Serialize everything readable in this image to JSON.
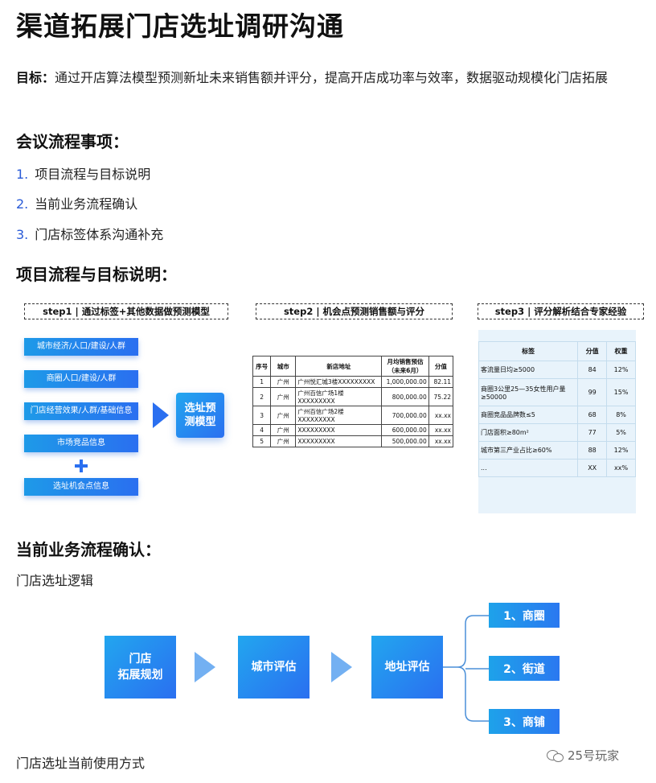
{
  "title": "渠道拓展门店选址调研沟通",
  "goal": {
    "label": "目标：",
    "text": "通过开店算法模型预测新址未来销售额并评分，提高开店成功率与效率，数据驱动规模化门店拓展"
  },
  "agenda": {
    "heading": "会议流程事项：",
    "items": [
      {
        "num": "1.",
        "label": "项目流程与目标说明"
      },
      {
        "num": "2.",
        "label": "当前业务流程确认"
      },
      {
        "num": "3.",
        "label": "门店标签体系沟通补充"
      }
    ]
  },
  "section1": {
    "heading": "项目流程与目标说明：",
    "step1": {
      "label": "step1 | 通过标签+其他数据做预测模型",
      "inputs": [
        "城市经济/人口/建设/人群",
        "商圈人口/建设/人群",
        "门店经营效果/人群/基础信息",
        "市场竞品信息",
        "选址机会点信息"
      ],
      "model": "选址预\n测模型"
    },
    "step2": {
      "label": "step2 | 机会点预测销售额与评分",
      "headers": [
        "序号",
        "城市",
        "新店地址",
        "月均销售预估\n（未来6月）",
        "分值"
      ],
      "rows": [
        [
          "1",
          "广州",
          "广州悦汇城3楼XXXXXXXXX",
          "1,000,000.00",
          "82.11"
        ],
        [
          "2",
          "广州",
          "广州百信广场1楼\nXXXXXXXXX",
          "800,000.00",
          "75.22"
        ],
        [
          "3",
          "广州",
          "广州百信广场2楼\nXXXXXXXXX",
          "700,000.00",
          "xx.xx"
        ],
        [
          "4",
          "广州",
          "XXXXXXXXX",
          "600,000.00",
          "xx.xx"
        ],
        [
          "5",
          "广州",
          "XXXXXXXXX",
          "500,000.00",
          "xx.xx"
        ]
      ]
    },
    "step3": {
      "label": "step3 | 评分解析结合专家经验",
      "headers": [
        "标签",
        "分值",
        "权重"
      ],
      "rows": [
        [
          "客流量日均≥5000",
          "84",
          "12%"
        ],
        [
          "商圈3公里25—35女性用户量≥50000",
          "99",
          "15%"
        ],
        [
          "商圈竞品品牌数≤5",
          "68",
          "8%"
        ],
        [
          "门店面积≥80m²",
          "77",
          "5%"
        ],
        [
          "城市第三产业占比≥60%",
          "88",
          "12%"
        ],
        [
          "...",
          "XX",
          "xx%"
        ]
      ]
    }
  },
  "section2": {
    "heading": "当前业务流程确认：",
    "subheading": "门店选址逻辑",
    "flow": [
      "门店\n拓展规划",
      "城市评估",
      "地址评估"
    ],
    "leaves": [
      "1、商圈",
      "2、街道",
      "3、商铺"
    ],
    "footer": "门店选址当前使用方式"
  },
  "watermark": "25号玩家",
  "colors": {
    "accent": "#2a6ff0",
    "accent_light": "#1e9ae8",
    "list_number": "#2a5bd7",
    "table_bg": "#e8f3fb"
  }
}
